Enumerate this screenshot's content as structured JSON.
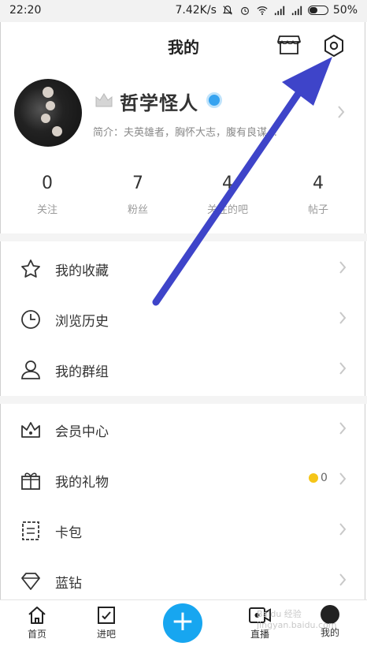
{
  "status_bar": {
    "time": "22:20",
    "network_speed": "7.42K/s",
    "battery_pct": "50%",
    "battery_level": 0.5
  },
  "header": {
    "title": "我的",
    "shop_icon": "storefront-icon",
    "settings_icon": "hexagon-settings-icon"
  },
  "profile": {
    "name": "哲学怪人",
    "bio": "简介：夫英雄者，胸怀大志，腹有良谋…",
    "level_icon": "level-badge-icon",
    "verified_icon": "verified-icon",
    "verified_color": "#36a3f0"
  },
  "stats": [
    {
      "value": "0",
      "label": "关注"
    },
    {
      "value": "7",
      "label": "粉丝"
    },
    {
      "value": "4",
      "label": "关注的吧"
    },
    {
      "value": "4",
      "label": "帖子"
    }
  ],
  "menu_group_1": [
    {
      "label": "我的收藏",
      "icon": "star-outline-icon"
    },
    {
      "label": "浏览历史",
      "icon": "clock-icon"
    },
    {
      "label": "我的群组",
      "icon": "person-group-icon"
    }
  ],
  "menu_group_2": [
    {
      "label": "会员中心",
      "icon": "crown-icon"
    },
    {
      "label": "我的礼物",
      "icon": "gift-icon",
      "badge": "0"
    },
    {
      "label": "卡包",
      "icon": "card-wallet-icon"
    },
    {
      "label": "蓝钻",
      "icon": "diamond-icon"
    }
  ],
  "bottom_nav": [
    {
      "label": "首页",
      "icon": "home-icon"
    },
    {
      "label": "进吧",
      "icon": "enter-bar-icon"
    },
    {
      "label": "+",
      "icon": "plus-icon"
    },
    {
      "label": "直播",
      "icon": "live-camera-icon"
    },
    {
      "label": "我的",
      "icon": "me-avatar-icon"
    }
  ],
  "watermark": "Baidu 经验 jingyan.baidu.com",
  "annotation": {
    "arrow_color": "#3e44c9"
  },
  "colors": {
    "accent": "#17a6f0",
    "coin": "#f5c518"
  }
}
